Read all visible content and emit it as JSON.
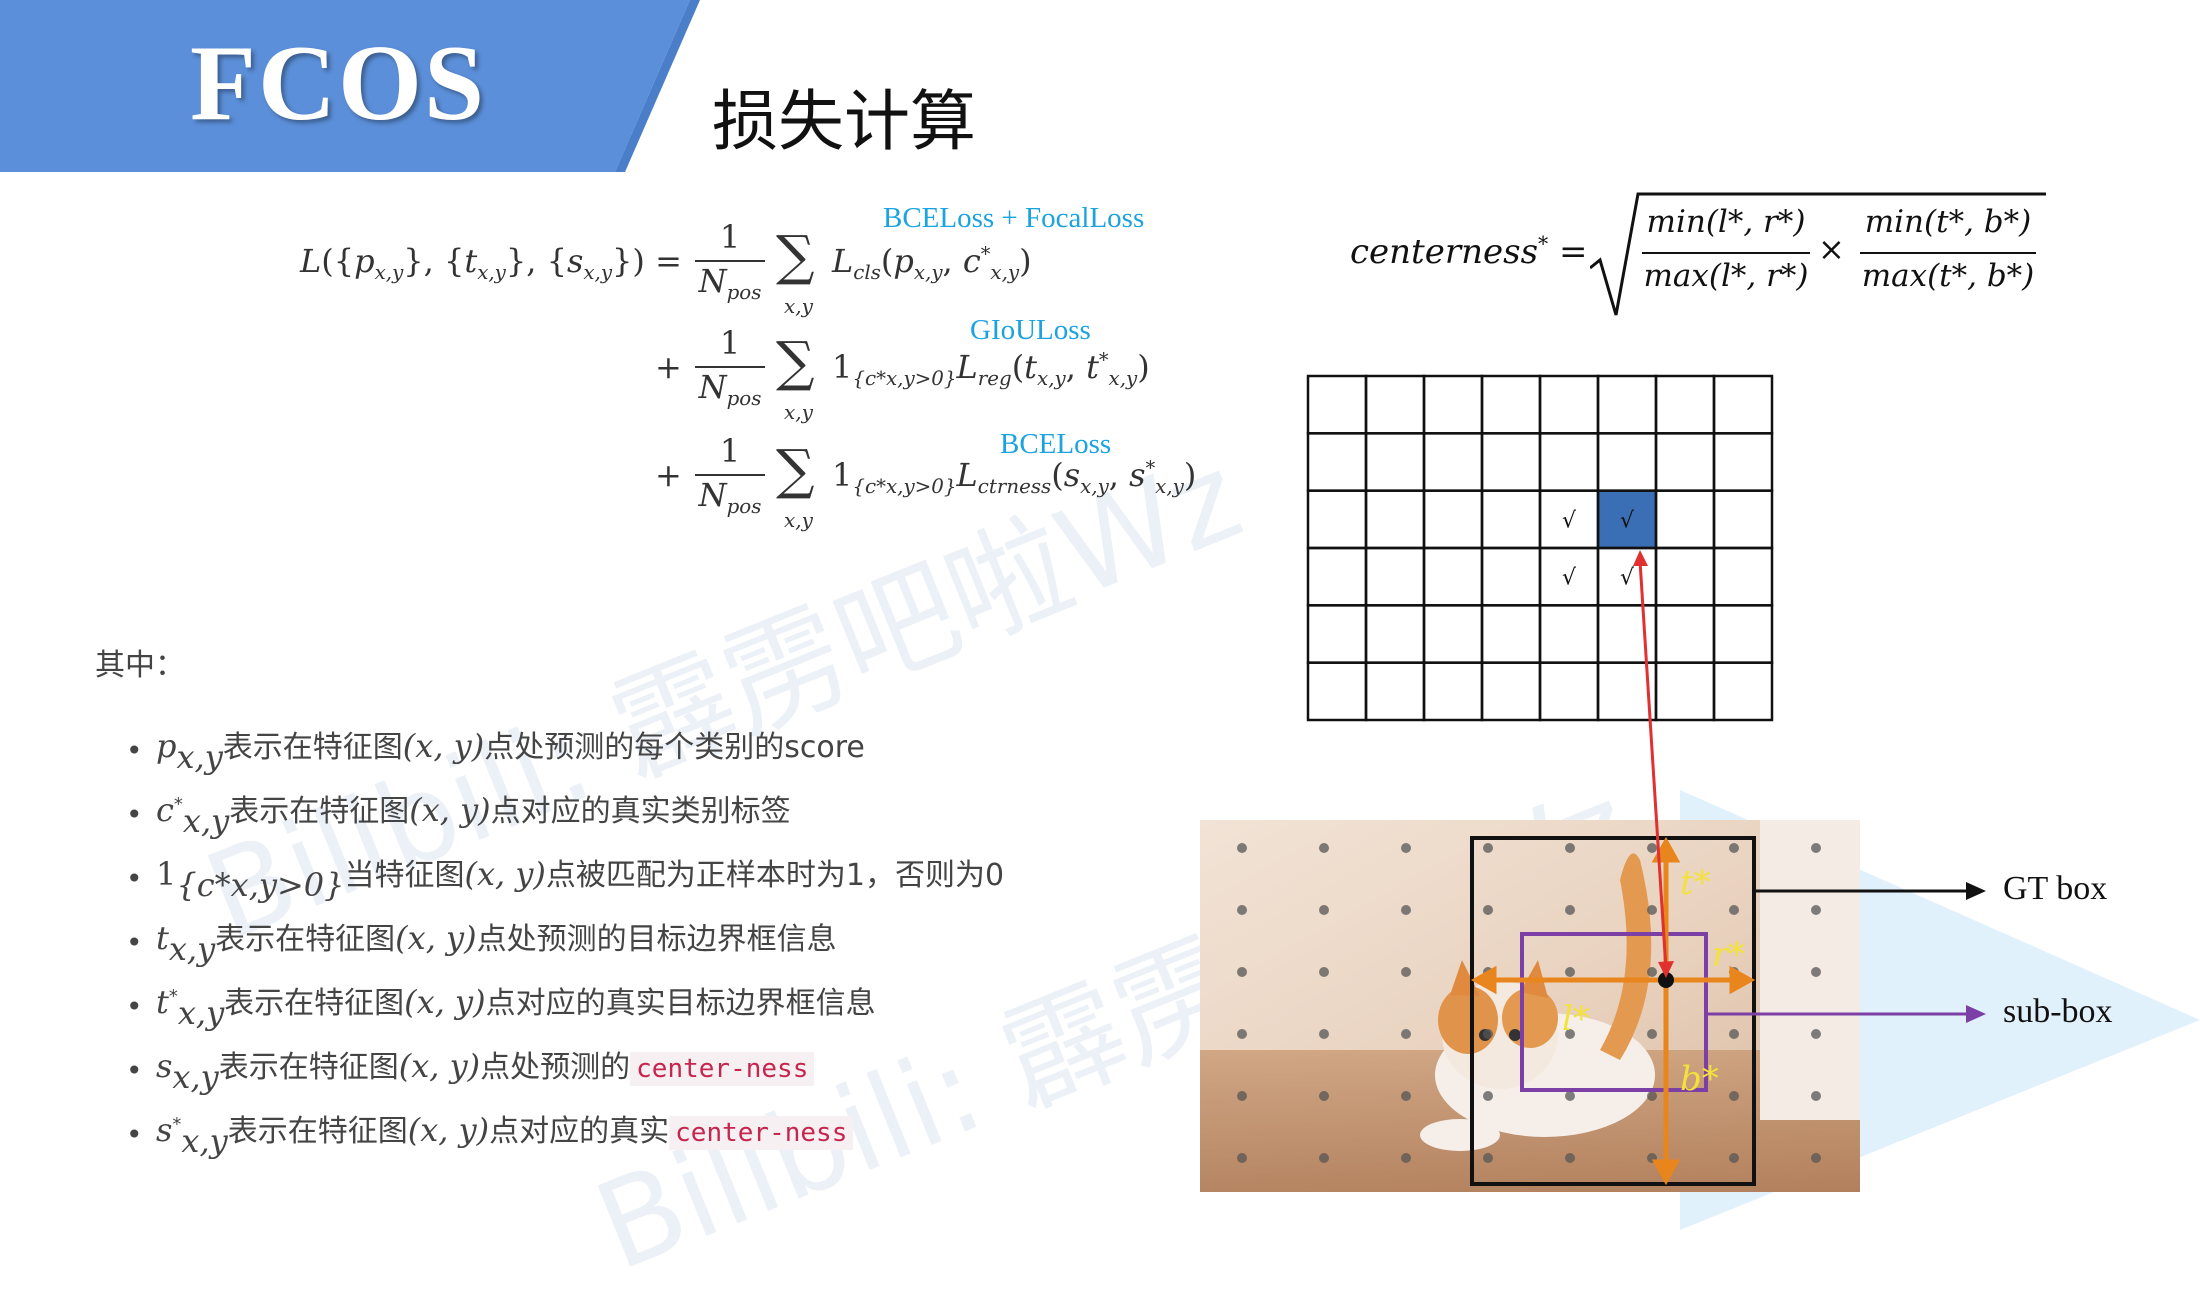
{
  "header": {
    "logo_text": "FCOS",
    "title": "损失计算"
  },
  "watermark": {
    "line1": "Bilibili: 霹雳吧啦Wz",
    "line2": "Bilibili: 霹雳吧啦Wz"
  },
  "loss_formula": {
    "lhs": "L({p_x,y}, {t_x,y}, {s_x,y}) =",
    "term1_tag": "BCELoss + FocalLoss",
    "term2_tag": "GIoULoss",
    "term3_tag": "BCELoss",
    "numerator": "1",
    "denominator": "N",
    "denominator_sub": "pos",
    "sum_index": "x,y",
    "plus": "+"
  },
  "centerness_formula": {
    "lhs": "centerness",
    "numerator_left": "min(l*, r*)",
    "denominator_left": "max(l*, r*)",
    "numerator_right": "min(t*, b*)",
    "denominator_right": "max(t*, b*)",
    "times": "×"
  },
  "where": {
    "label": "其中：",
    "items": [
      {
        "symbol": "p",
        "sub": "x,y",
        "text_a": "表示在特征图",
        "coord": "(x, y)",
        "text_b": "点处预测的每个类别的score",
        "code": ""
      },
      {
        "symbol": "c",
        "sub": "x,y",
        "sup": "*",
        "text_a": "表示在特征图",
        "coord": "(x, y)",
        "text_b": "点对应的真实类别标签",
        "code": ""
      },
      {
        "symbol": "1",
        "sub": "{c*x,y>0}",
        "text_a": "当特征图",
        "coord": "(x, y)",
        "text_b": "点被匹配为正样本时为1，否则为0",
        "code": ""
      },
      {
        "symbol": "t",
        "sub": "x,y",
        "text_a": "表示在特征图",
        "coord": "(x, y)",
        "text_b": "点处预测的目标边界框信息",
        "code": ""
      },
      {
        "symbol": "t",
        "sub": "x,y",
        "sup": "*",
        "text_a": "表示在特征图",
        "coord": "(x, y)",
        "text_b": "点对应的真实目标边界框信息",
        "code": ""
      },
      {
        "symbol": "s",
        "sub": "x,y",
        "text_a": "表示在特征图",
        "coord": "(x, y)",
        "text_b": "点处预测的",
        "code": "center-ness"
      },
      {
        "symbol": "s",
        "sub": "x,y",
        "sup": "*",
        "text_a": "表示在特征图",
        "coord": "(x, y)",
        "text_b": "点对应的真实",
        "code": "center-ness"
      }
    ]
  },
  "feature_grid": {
    "rows": 6,
    "cols": 8,
    "highlight_cell": [
      2,
      5
    ],
    "check_cells": [
      [
        2,
        4
      ],
      [
        2,
        5
      ],
      [
        3,
        4
      ],
      [
        3,
        5
      ]
    ],
    "check_mark": "√",
    "highlight_color": "#3a6fb5"
  },
  "diagram": {
    "gt_box_label": "GT box",
    "sub_box_label": "sub-box",
    "label_t": "t*",
    "label_r": "r*",
    "label_l": "l*",
    "label_b": "b*",
    "colors": {
      "gt_box": "#111111",
      "sub_box": "#7b3fa6",
      "arrows": "#e8851c",
      "pointer": "#e03030",
      "labels": "#f2e23a"
    }
  },
  "colors": {
    "banner": "#5b8fd9",
    "tag": "#1aa3e0"
  }
}
